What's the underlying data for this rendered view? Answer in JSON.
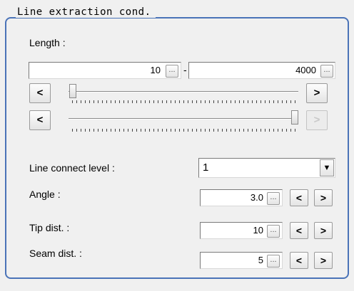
{
  "group": {
    "title": "Line extraction cond."
  },
  "length": {
    "label": "Length :",
    "min_value": "10",
    "max_value": "4000",
    "separator": "-",
    "ellipsis": "...",
    "left_arrow": "<",
    "right_arrow": ">",
    "min_slider_level": 0.0025,
    "max_slider_level": 1.0
  },
  "line_connect": {
    "label": "Line connect level :",
    "value": "1",
    "dropdown_icon": "▼"
  },
  "angle": {
    "label": "Angle :",
    "value": "3.0",
    "ellipsis": "...",
    "dec": "<",
    "inc": ">"
  },
  "tip_dist": {
    "label": "Tip dist. :",
    "value": "10",
    "ellipsis": "...",
    "dec": "<",
    "inc": ">"
  },
  "seam_dist": {
    "label": "Seam dist. :",
    "value": "5",
    "ellipsis": "...",
    "dec": "<",
    "inc": ">"
  }
}
